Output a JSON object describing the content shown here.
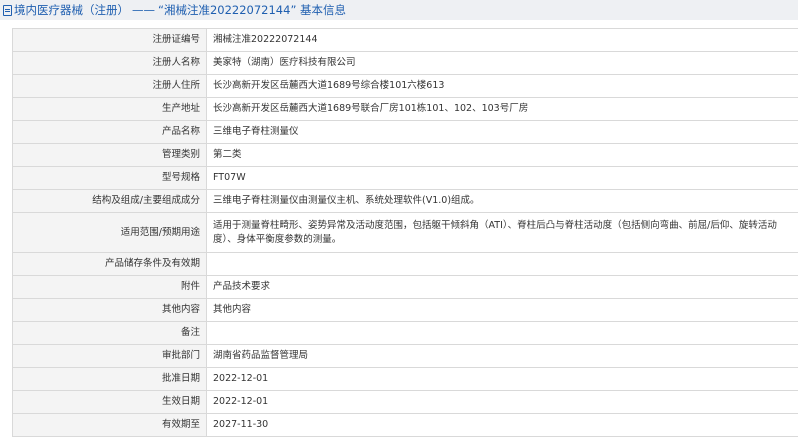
{
  "header": {
    "title_prefix": "境内医疗器械（注册）",
    "separator": "——",
    "title_suffix": "“湘械注准20222072144” 基本信息",
    "accent_color": "#1f5fb0",
    "icon": "document-icon"
  },
  "rows": [
    {
      "label": "注册证编号",
      "value": "湘械注准20222072144"
    },
    {
      "label": "注册人名称",
      "value": "美家特（湖南）医疗科技有限公司"
    },
    {
      "label": "注册人住所",
      "value": "长沙高新开发区岳麓西大道1689号综合楼101六楼613"
    },
    {
      "label": "生产地址",
      "value": "长沙高新开发区岳麓西大道1689号联合厂房101栋101、102、103号厂房"
    },
    {
      "label": "产品名称",
      "value": "三维电子脊柱测量仪"
    },
    {
      "label": "管理类别",
      "value": "第二类"
    },
    {
      "label": "型号规格",
      "value": "FT07W"
    },
    {
      "label": "结构及组成/主要组成成分",
      "value": "三维电子脊柱测量仪由测量仪主机、系统处理软件(V1.0)组成。"
    },
    {
      "label": "适用范围/预期用途",
      "value": "适用于测量脊柱畸形、姿势异常及活动度范围，包括躯干倾斜角（ATI）、脊柱后凸与脊柱活动度（包括侧向弯曲、前屈/后仰、旋转活动度）、身体平衡度参数的测量。"
    },
    {
      "label": "产品储存条件及有效期",
      "value": ""
    },
    {
      "label": "附件",
      "value": "产品技术要求"
    },
    {
      "label": "其他内容",
      "value": "其他内容"
    },
    {
      "label": "备注",
      "value": ""
    },
    {
      "label": "审批部门",
      "value": "湖南省药品监督管理局"
    },
    {
      "label": "批准日期",
      "value": "2022-12-01"
    },
    {
      "label": "生效日期",
      "value": "2022-12-01"
    },
    {
      "label": "有效期至",
      "value": "2027-11-30"
    }
  ]
}
